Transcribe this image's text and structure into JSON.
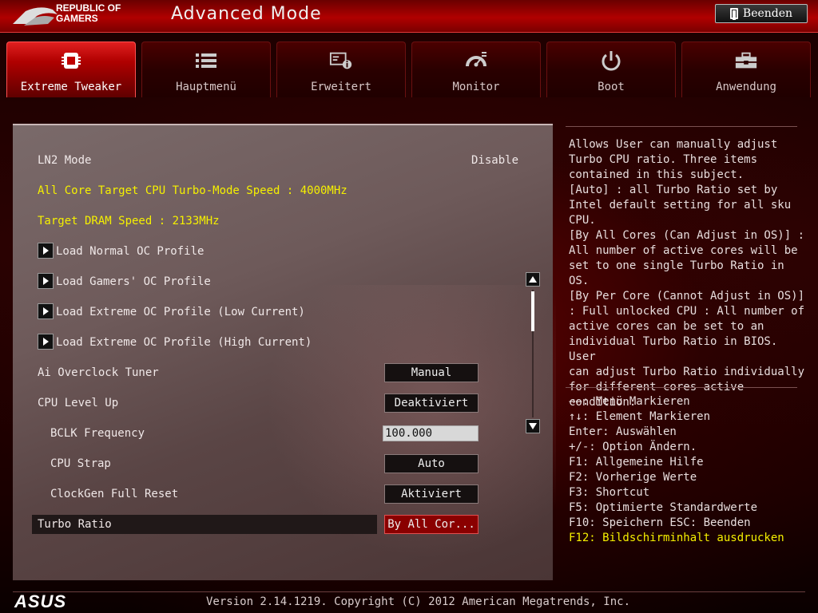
{
  "header": {
    "brand_line1": "REPUBLIC OF",
    "brand_line2": "GAMERS",
    "title": "Advanced Mode",
    "exit_label": "Beenden"
  },
  "tabs": [
    {
      "label": "Extreme Tweaker",
      "icon": "cpu-chip-icon",
      "active": true
    },
    {
      "label": "Hauptmenü",
      "icon": "list-icon",
      "active": false
    },
    {
      "label": "Erweitert",
      "icon": "advanced-info-icon",
      "active": false
    },
    {
      "label": "Monitor",
      "icon": "gauge-icon",
      "active": false
    },
    {
      "label": "Boot",
      "icon": "power-icon",
      "active": false
    },
    {
      "label": "Anwendung",
      "icon": "toolbox-icon",
      "active": false
    }
  ],
  "main": {
    "ln2_label": "LN2 Mode",
    "ln2_value": "Disable",
    "cpu_turbo_info": "All Core Target CPU Turbo-Mode Speed : 4000MHz",
    "dram_info": "Target DRAM Speed : 2133MHz",
    "profiles": [
      "Load Normal OC Profile",
      "Load Gamers' OC Profile",
      "Load Extreme OC Profile (Low Current)",
      "Load Extreme OC Profile (High Current)"
    ],
    "ai_tuner_label": "Ai Overclock Tuner",
    "ai_tuner_value": "Manual",
    "cpu_level_label": "CPU Level Up",
    "cpu_level_value": "Deaktiviert",
    "bclk_label": "BCLK Frequency",
    "bclk_value": "100.000",
    "cpu_strap_label": "CPU Strap",
    "cpu_strap_value": "Auto",
    "clockgen_label": "ClockGen Full Reset",
    "clockgen_value": "Aktiviert",
    "turbo_label": "Turbo Ratio",
    "turbo_value": "By All Cor..."
  },
  "help": {
    "text": "Allows User can manually adjust\nTurbo CPU ratio. Three items\ncontained in this subject.\n[Auto] : all Turbo Ratio set by\nIntel default setting for all sku\nCPU.\n[By All Cores (Can Adjust in OS)] :\nAll number of active cores will be\nset to one single Turbo Ratio in OS.\n[By Per Core (Cannot Adjust in OS)]\n: Full unlocked CPU : All number of\nactive cores can be set to an\nindividual Turbo Ratio in BIOS. User\ncan adjust Turbo Ratio individually\nfor different cores active condition."
  },
  "keys": [
    "→←: Menü Markieren",
    "↑↓: Element Markieren",
    "Enter: Auswählen",
    "+/-: Option Ändern.",
    "F1: Allgemeine Hilfe",
    "F2: Vorherige Werte",
    "F3: Shortcut",
    "F5: Optimierte Standardwerte",
    "F10: Speichern  ESC: Beenden",
    "F12: Bildschirminhalt ausdrucken"
  ],
  "footer": {
    "logo": "ASUS",
    "version": "Version 2.14.1219. Copyright (C) 2012 American Megatrends, Inc."
  },
  "colors": {
    "accent_red": "#b00000",
    "highlight_yellow": "#f5f000"
  }
}
